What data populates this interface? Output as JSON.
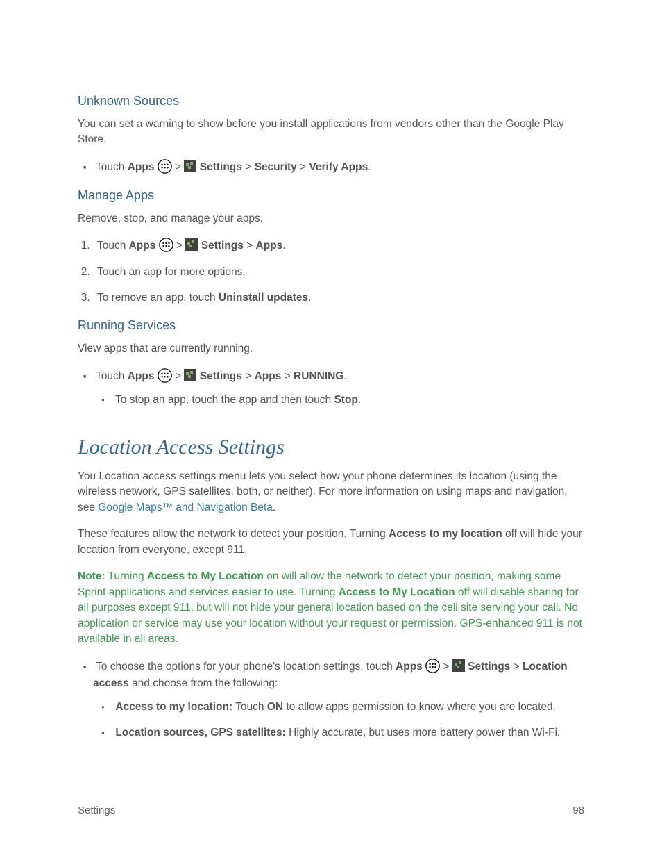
{
  "sections": {
    "unknown": {
      "heading": "Unknown Sources",
      "intro": "You can set a warning to show before you install applications from vendors other than the Google Play Store.",
      "step_prefix": "Touch ",
      "apps_label": "Apps",
      "settings_label": "Settings",
      "security_label": "Security",
      "verify_label": "Verify Apps"
    },
    "manage": {
      "heading": "Manage Apps",
      "intro": "Remove, stop, and manage your apps.",
      "step1_prefix": "Touch ",
      "apps_label": "Apps",
      "settings_label": "Settings",
      "apps2_label": "Apps",
      "step2": "Touch an app for more options.",
      "step3_prefix": "To remove an app, touch ",
      "step3_bold": "Uninstall updates"
    },
    "running": {
      "heading": "Running Services",
      "intro": "View apps that are currently running.",
      "step_prefix": "Touch ",
      "apps_label": "Apps",
      "settings_label": "Settings",
      "apps2_label": "Apps",
      "running_label": "RUNNING",
      "sub_prefix": "To stop an app, touch the app and then touch ",
      "sub_bold": "Stop"
    },
    "location": {
      "heading": "Location Access Settings",
      "p1_a": "You Location access settings menu lets you select how your phone determines its location (using the wireless network, GPS satellites, both, or neither). For more information on using maps and navigation, see ",
      "p1_link": "Google Maps™ and Navigation Beta",
      "p1_b": ".",
      "p2_a": "These features allow the network to detect your position. Turning ",
      "p2_bold": "Access to my location",
      "p2_b": " off will hide your location from everyone, except 911.",
      "note_label": "Note:",
      "note_a": " Turning ",
      "note_bold1": "Access to My Location",
      "note_b": " on will allow the network to detect your position, making some Sprint applications and services easier to use. Turning ",
      "note_bold2": "Access to My Location",
      "note_c": " off will disable sharing for all purposes except 911, but will not hide your general location based on the cell site serving your call. No application or service may use your location without your request or permission. GPS-enhanced 911 is not available in all areas.",
      "bullet_prefix": "To choose the options for your phone's location settings, touch ",
      "apps_label": "Apps",
      "settings_label": "Settings",
      "location_access_label": "Location access",
      "bullet_suffix": " and choose from the following:",
      "sub1_bold": "Access to my location:",
      "sub1_a": " Touch ",
      "sub1_on": "ON",
      "sub1_b": " to allow apps permission to know where you are located.",
      "sub2_bold": "Location sources, GPS satellites:",
      "sub2_text": " Highly accurate, but uses more battery power than Wi-Fi."
    }
  },
  "footer": {
    "left": "Settings",
    "right": "98"
  }
}
